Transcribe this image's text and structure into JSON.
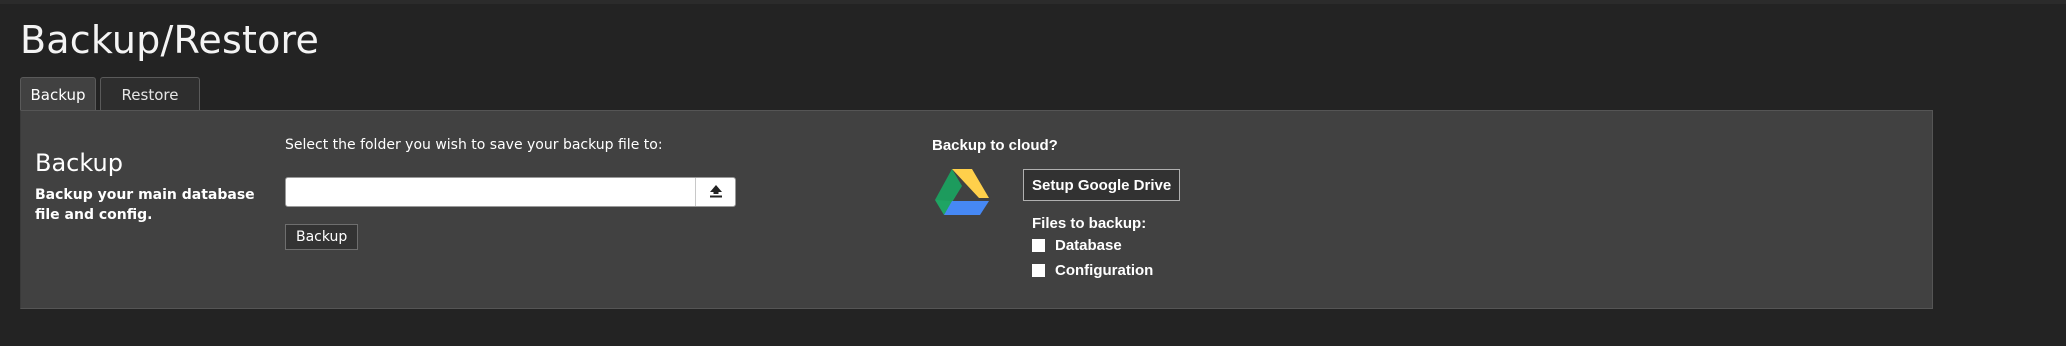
{
  "page": {
    "title": "Backup/Restore"
  },
  "tabs": [
    {
      "label": "Backup",
      "active": true
    },
    {
      "label": "Restore",
      "active": false
    }
  ],
  "backup_section": {
    "title": "Backup",
    "description": "Backup your main database file and config.",
    "folder_label": "Select the folder you wish to save your backup file to:",
    "folder_value": "",
    "folder_placeholder": "",
    "browse_icon": "upload-icon",
    "backup_button": "Backup"
  },
  "cloud_section": {
    "title": "Backup to cloud?",
    "logo_icon": "google-drive-logo-icon",
    "setup_button": "Setup Google Drive",
    "files_label": "Files to backup:",
    "options": [
      {
        "label": "Database",
        "checked": false
      },
      {
        "label": "Configuration",
        "checked": false
      }
    ]
  },
  "colors": {
    "background": "#232323",
    "panel": "#414141",
    "drive_green": "#1fa463",
    "drive_yellow": "#ffd04b",
    "drive_blue": "#4688f4"
  }
}
